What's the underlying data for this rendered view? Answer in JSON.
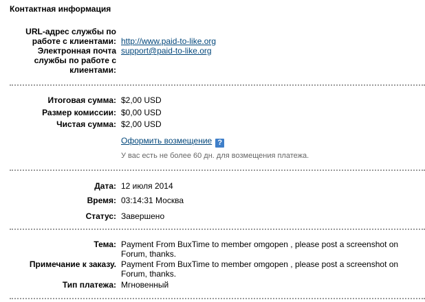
{
  "section_title": "Контактная информация",
  "contact": {
    "url_label": "URL-адрес службы по работе с клиентами:",
    "url_value": "http://www.paid-to-like.org",
    "email_label": "Электронная почта службы по работе с клиентами:",
    "email_value": "support@paid-to-like.org"
  },
  "amounts": {
    "total_label": "Итоговая сумма:",
    "total_value": "$2,00 USD",
    "fee_label": "Размер комиссии:",
    "fee_value": "$0,00 USD",
    "net_label": "Чистая сумма:",
    "net_value": "$2,00 USD",
    "refund_link": "Оформить возмещение",
    "help_icon_glyph": "?",
    "refund_note": "У вас есть не более 60 дн. для возмещения платежа."
  },
  "details": {
    "date_label": "Дата:",
    "date_value": "12 июля 2014",
    "time_label": "Время:",
    "time_value": "03:14:31 Москва",
    "status_label": "Статус:",
    "status_value": "Завершено"
  },
  "memo": {
    "subject_label": "Тема:",
    "subject_value": "Payment From BuxTime to member omgopen , please post a screenshot on Forum, thanks.",
    "note_label": "Примечание к заказу.",
    "note_value": "Payment From BuxTime to member omgopen , please post a screenshot on Forum, thanks.",
    "type_label": "Тип платежа:",
    "type_value": "Мгновенный"
  },
  "colors": {
    "link": "#03477b",
    "separator": "#9a9a9a",
    "help_icon": "#3f7fc9"
  }
}
